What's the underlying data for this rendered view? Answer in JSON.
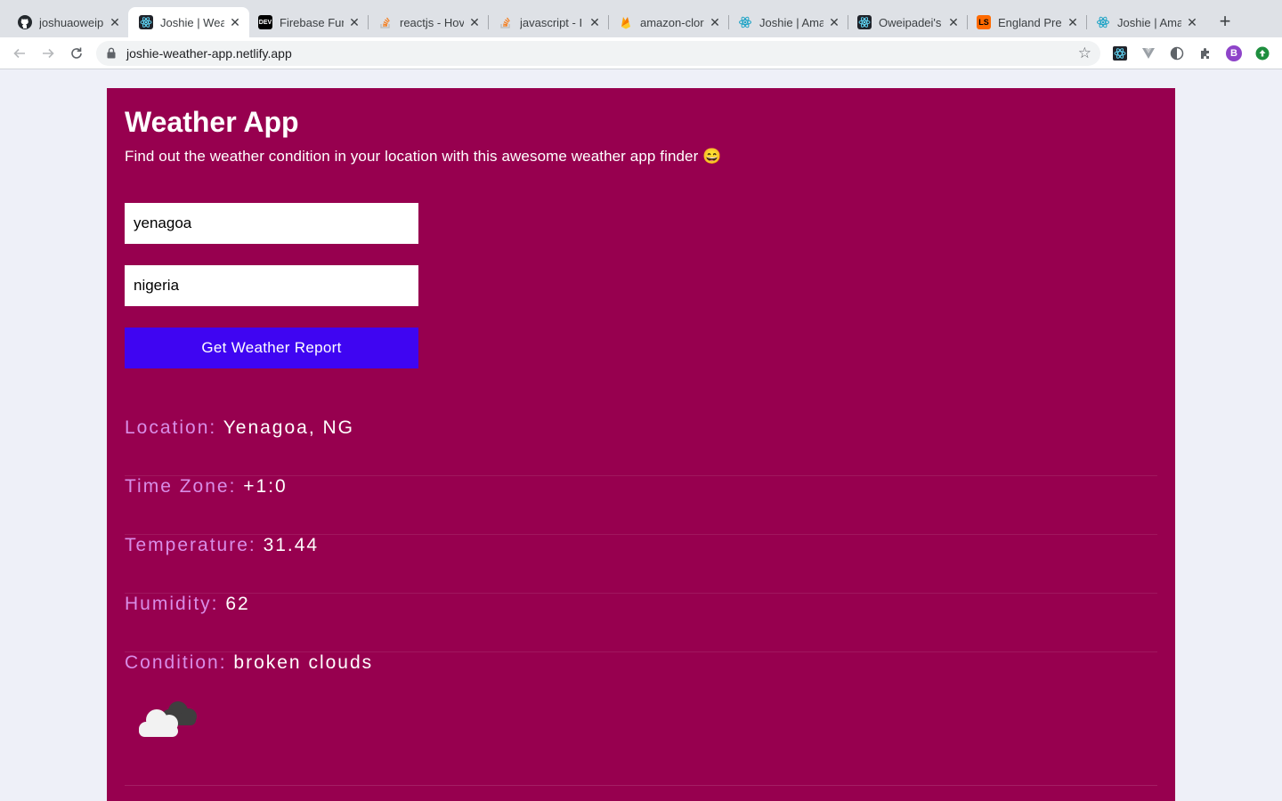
{
  "browser": {
    "tabs": [
      {
        "title": "joshuaoweip",
        "favicon": "github-icon",
        "active": false
      },
      {
        "title": "Joshie | Wea",
        "favicon": "react-icon",
        "active": true
      },
      {
        "title": "Firebase Fur",
        "favicon": "dev-icon",
        "active": false
      },
      {
        "title": "reactjs - Hov",
        "favicon": "stackoverflow-icon",
        "active": false
      },
      {
        "title": "javascript - I",
        "favicon": "stackoverflow-icon",
        "active": false
      },
      {
        "title": "amazon-clor",
        "favicon": "firebase-icon",
        "active": false
      },
      {
        "title": "Joshie | Ama",
        "favicon": "react-icon",
        "active": false
      },
      {
        "title": "Oweipadei's",
        "favicon": "react-icon",
        "active": false
      },
      {
        "title": "England Pre",
        "favicon": "livescore-icon",
        "active": false
      },
      {
        "title": "Joshie | Ama",
        "favicon": "react-icon",
        "active": false
      }
    ],
    "dev_favicon_text": "DEV",
    "url": "joshie-weather-app.netlify.app",
    "profile_initial": "B"
  },
  "app": {
    "title": "Weather App",
    "subtitle": "Find out the weather condition in your location with this awesome weather app finder 😄",
    "city_value": "yenagoa",
    "country_value": "nigeria",
    "submit_label": "Get Weather Report",
    "results": {
      "location_label": "Location:",
      "location_value": "Yenagoa, NG",
      "timezone_label": "Time Zone:",
      "timezone_value": "+1:0",
      "temperature_label": "Temperature:",
      "temperature_value": "31.44",
      "humidity_label": "Humidity:",
      "humidity_value": "62",
      "condition_label": "Condition:",
      "condition_value": "broken clouds"
    },
    "condition_icon": "broken-clouds-icon"
  },
  "colors": {
    "card_bg": "#97004f",
    "button_bg": "#3f05f2",
    "label_color": "#d88de6",
    "page_bg": "#eef0f8"
  }
}
